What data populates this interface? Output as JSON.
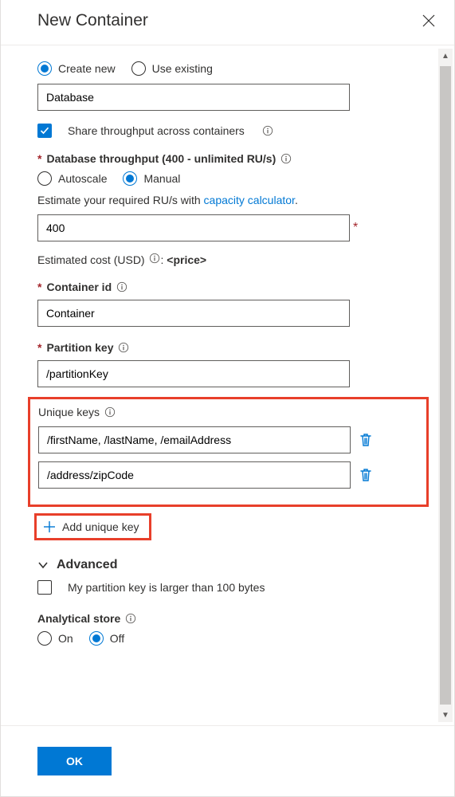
{
  "title": "New Container",
  "database": {
    "create_new_label": "Create new",
    "use_existing_label": "Use existing",
    "selected": "create_new",
    "value": "Database",
    "share_throughput_label": "Share throughput across containers",
    "share_throughput_checked": true
  },
  "throughput": {
    "label": "Database throughput (400 - unlimited RU/s)",
    "mode_autoscale_label": "Autoscale",
    "mode_manual_label": "Manual",
    "mode_selected": "manual",
    "hint_prefix": "Estimate your required RU/s with ",
    "hint_link": "capacity calculator",
    "hint_suffix": ".",
    "value": "400",
    "cost_prefix": "Estimated cost (USD) ",
    "cost_price": "<price>"
  },
  "container": {
    "id_label": "Container id",
    "id_value": "Container",
    "pk_label": "Partition key",
    "pk_value": "/partitionKey"
  },
  "unique_keys": {
    "label": "Unique keys",
    "items": [
      "/firstName, /lastName, /emailAddress",
      "/address/zipCode"
    ],
    "add_label": "Add unique key"
  },
  "advanced": {
    "label": "Advanced",
    "pk_large_label": "My partition key is larger than 100 bytes",
    "pk_large_checked": false
  },
  "analytical": {
    "label": "Analytical store",
    "on_label": "On",
    "off_label": "Off",
    "selected": "off"
  },
  "footer": {
    "ok_label": "OK"
  },
  "icons": {
    "colon": ":"
  }
}
